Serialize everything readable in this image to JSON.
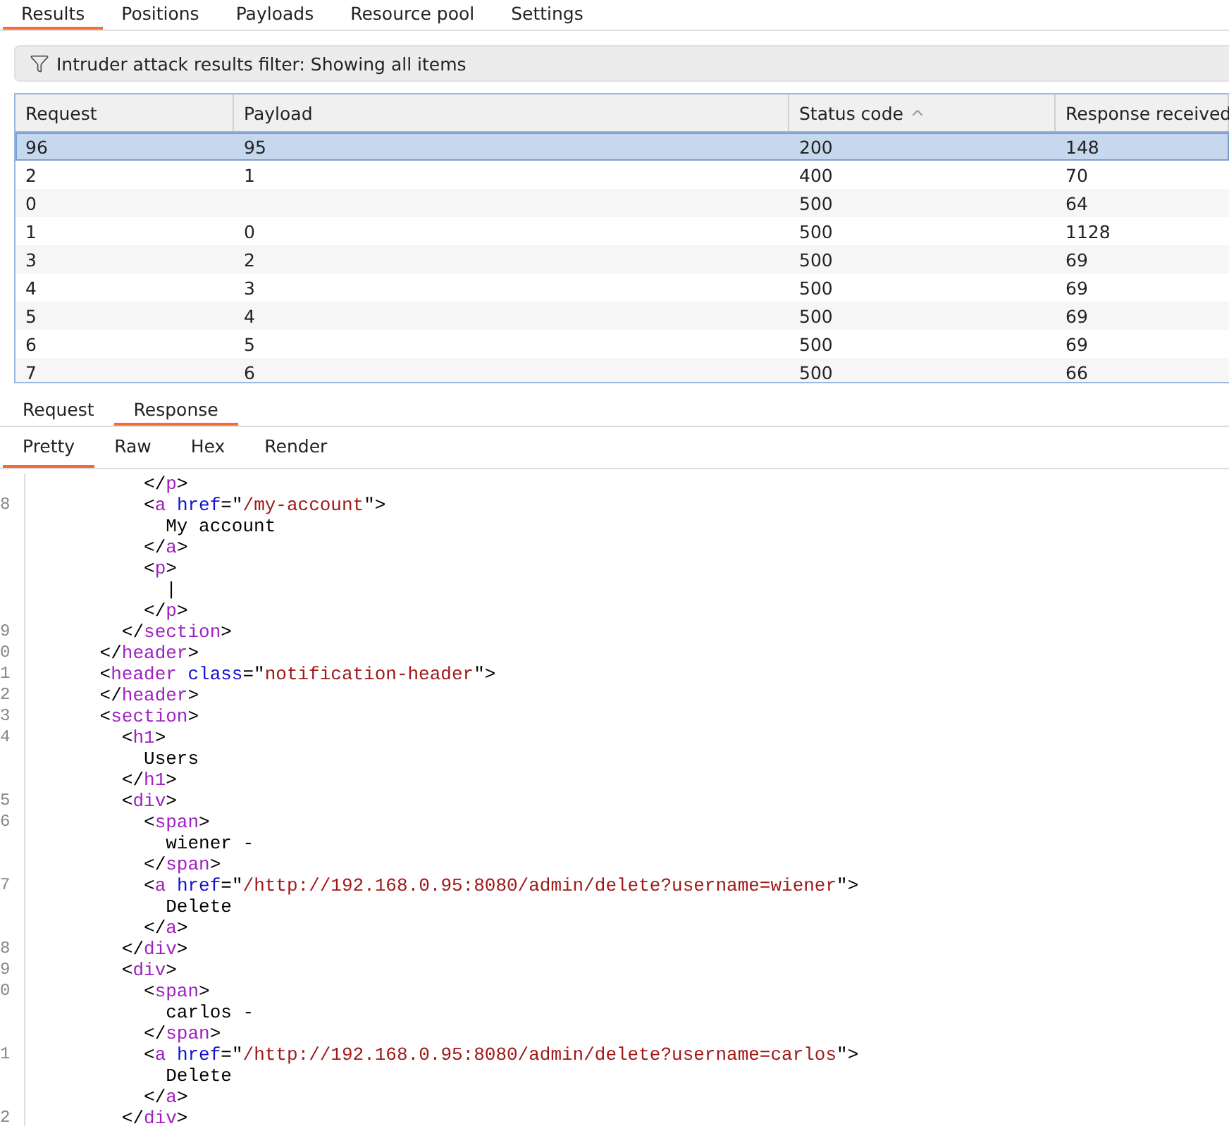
{
  "top_tabs": [
    {
      "label": "Results",
      "selected": true
    },
    {
      "label": "Positions",
      "selected": false
    },
    {
      "label": "Payloads",
      "selected": false
    },
    {
      "label": "Resource pool",
      "selected": false
    },
    {
      "label": "Settings",
      "selected": false
    }
  ],
  "filter": {
    "text": "Intruder attack results filter: Showing all items"
  },
  "table": {
    "columns": [
      {
        "label": "Request"
      },
      {
        "label": "Payload"
      },
      {
        "label": "Status code",
        "sorted": true
      },
      {
        "label": "Response received"
      }
    ],
    "rows": [
      {
        "cells": [
          "96",
          "95",
          "200",
          "148"
        ],
        "selected": true
      },
      {
        "cells": [
          "2",
          "1",
          "400",
          "70"
        ],
        "selected": false
      },
      {
        "cells": [
          "0",
          "",
          "500",
          "64"
        ],
        "selected": false
      },
      {
        "cells": [
          "1",
          "0",
          "500",
          "1128"
        ],
        "selected": false
      },
      {
        "cells": [
          "3",
          "2",
          "500",
          "69"
        ],
        "selected": false
      },
      {
        "cells": [
          "4",
          "3",
          "500",
          "69"
        ],
        "selected": false
      },
      {
        "cells": [
          "5",
          "4",
          "500",
          "69"
        ],
        "selected": false
      },
      {
        "cells": [
          "6",
          "5",
          "500",
          "69"
        ],
        "selected": false
      },
      {
        "cells": [
          "7",
          "6",
          "500",
          "66"
        ],
        "selected": false
      }
    ]
  },
  "message_tabs": [
    {
      "label": "Request",
      "selected": false
    },
    {
      "label": "Response",
      "selected": true
    }
  ],
  "view_tabs": [
    {
      "label": "Pretty",
      "selected": true
    },
    {
      "label": "Raw",
      "selected": false
    },
    {
      "label": "Hex",
      "selected": false
    },
    {
      "label": "Render",
      "selected": false
    }
  ],
  "code": [
    {
      "tokens": [
        {
          "kind": "punct",
          "text": "          </"
        },
        {
          "kind": "tag",
          "text": "p"
        },
        {
          "kind": "punct",
          "text": ">"
        }
      ]
    },
    {
      "number": "8",
      "tokens": [
        {
          "kind": "punct",
          "text": "          <"
        },
        {
          "kind": "tag",
          "text": "a"
        },
        {
          "kind": "attr",
          "text": " href"
        },
        {
          "kind": "punct",
          "text": "=\""
        },
        {
          "kind": "value",
          "text": "/my-account"
        },
        {
          "kind": "punct",
          "text": "\">"
        }
      ]
    },
    {
      "tokens": [
        {
          "kind": "punct",
          "text": "            My account"
        }
      ]
    },
    {
      "tokens": [
        {
          "kind": "punct",
          "text": "          </"
        },
        {
          "kind": "tag",
          "text": "a"
        },
        {
          "kind": "punct",
          "text": ">"
        }
      ]
    },
    {
      "tokens": [
        {
          "kind": "punct",
          "text": "          <"
        },
        {
          "kind": "tag",
          "text": "p"
        },
        {
          "kind": "punct",
          "text": ">"
        }
      ]
    },
    {
      "tokens": [
        {
          "kind": "punct",
          "text": "            |"
        }
      ]
    },
    {
      "tokens": [
        {
          "kind": "punct",
          "text": "          </"
        },
        {
          "kind": "tag",
          "text": "p"
        },
        {
          "kind": "punct",
          "text": ">"
        }
      ]
    },
    {
      "number": "9",
      "tokens": [
        {
          "kind": "punct",
          "text": "        </"
        },
        {
          "kind": "tag",
          "text": "section"
        },
        {
          "kind": "punct",
          "text": ">"
        }
      ]
    },
    {
      "number": "0",
      "tokens": [
        {
          "kind": "punct",
          "text": "      </"
        },
        {
          "kind": "tag",
          "text": "header"
        },
        {
          "kind": "punct",
          "text": ">"
        }
      ]
    },
    {
      "number": "1",
      "tokens": [
        {
          "kind": "punct",
          "text": "      <"
        },
        {
          "kind": "tag",
          "text": "header"
        },
        {
          "kind": "attr",
          "text": " class"
        },
        {
          "kind": "punct",
          "text": "=\""
        },
        {
          "kind": "value",
          "text": "notification-header"
        },
        {
          "kind": "punct",
          "text": "\">"
        }
      ]
    },
    {
      "number": "2",
      "tokens": [
        {
          "kind": "punct",
          "text": "      </"
        },
        {
          "kind": "tag",
          "text": "header"
        },
        {
          "kind": "punct",
          "text": ">"
        }
      ]
    },
    {
      "number": "3",
      "tokens": [
        {
          "kind": "punct",
          "text": "      <"
        },
        {
          "kind": "tag",
          "text": "section"
        },
        {
          "kind": "punct",
          "text": ">"
        }
      ]
    },
    {
      "number": "4",
      "tokens": [
        {
          "kind": "punct",
          "text": "        <"
        },
        {
          "kind": "tag",
          "text": "h1"
        },
        {
          "kind": "punct",
          "text": ">"
        }
      ]
    },
    {
      "tokens": [
        {
          "kind": "punct",
          "text": "          Users"
        }
      ]
    },
    {
      "tokens": [
        {
          "kind": "punct",
          "text": "        </"
        },
        {
          "kind": "tag",
          "text": "h1"
        },
        {
          "kind": "punct",
          "text": ">"
        }
      ]
    },
    {
      "number": "5",
      "tokens": [
        {
          "kind": "punct",
          "text": "        <"
        },
        {
          "kind": "tag",
          "text": "div"
        },
        {
          "kind": "punct",
          "text": ">"
        }
      ]
    },
    {
      "number": "6",
      "tokens": [
        {
          "kind": "punct",
          "text": "          <"
        },
        {
          "kind": "tag",
          "text": "span"
        },
        {
          "kind": "punct",
          "text": ">"
        }
      ]
    },
    {
      "tokens": [
        {
          "kind": "punct",
          "text": "            wiener -"
        }
      ]
    },
    {
      "tokens": [
        {
          "kind": "punct",
          "text": "          </"
        },
        {
          "kind": "tag",
          "text": "span"
        },
        {
          "kind": "punct",
          "text": ">"
        }
      ]
    },
    {
      "number": "7",
      "tokens": [
        {
          "kind": "punct",
          "text": "          <"
        },
        {
          "kind": "tag",
          "text": "a"
        },
        {
          "kind": "attr",
          "text": " href"
        },
        {
          "kind": "punct",
          "text": "=\""
        },
        {
          "kind": "value",
          "text": "/http://192.168.0.95:8080/admin/delete?username=wiener"
        },
        {
          "kind": "punct",
          "text": "\">"
        }
      ]
    },
    {
      "tokens": [
        {
          "kind": "punct",
          "text": "            Delete"
        }
      ]
    },
    {
      "tokens": [
        {
          "kind": "punct",
          "text": "          </"
        },
        {
          "kind": "tag",
          "text": "a"
        },
        {
          "kind": "punct",
          "text": ">"
        }
      ]
    },
    {
      "number": "8",
      "tokens": [
        {
          "kind": "punct",
          "text": "        </"
        },
        {
          "kind": "tag",
          "text": "div"
        },
        {
          "kind": "punct",
          "text": ">"
        }
      ]
    },
    {
      "number": "9",
      "tokens": [
        {
          "kind": "punct",
          "text": "        <"
        },
        {
          "kind": "tag",
          "text": "div"
        },
        {
          "kind": "punct",
          "text": ">"
        }
      ]
    },
    {
      "number": "0",
      "tokens": [
        {
          "kind": "punct",
          "text": "          <"
        },
        {
          "kind": "tag",
          "text": "span"
        },
        {
          "kind": "punct",
          "text": ">"
        }
      ]
    },
    {
      "tokens": [
        {
          "kind": "punct",
          "text": "            carlos -"
        }
      ]
    },
    {
      "tokens": [
        {
          "kind": "punct",
          "text": "          </"
        },
        {
          "kind": "tag",
          "text": "span"
        },
        {
          "kind": "punct",
          "text": ">"
        }
      ]
    },
    {
      "number": "1",
      "tokens": [
        {
          "kind": "punct",
          "text": "          <"
        },
        {
          "kind": "tag",
          "text": "a"
        },
        {
          "kind": "attr",
          "text": " href"
        },
        {
          "kind": "punct",
          "text": "=\""
        },
        {
          "kind": "value",
          "text": "/http://192.168.0.95:8080/admin/delete?username=carlos"
        },
        {
          "kind": "punct",
          "text": "\">"
        }
      ]
    },
    {
      "tokens": [
        {
          "kind": "punct",
          "text": "            Delete"
        }
      ]
    },
    {
      "tokens": [
        {
          "kind": "punct",
          "text": "          </"
        },
        {
          "kind": "tag",
          "text": "a"
        },
        {
          "kind": "punct",
          "text": ">"
        }
      ]
    },
    {
      "number": "2",
      "tokens": [
        {
          "kind": "punct",
          "text": "        </"
        },
        {
          "kind": "tag",
          "text": "div"
        },
        {
          "kind": "punct",
          "text": ">"
        }
      ]
    }
  ]
}
